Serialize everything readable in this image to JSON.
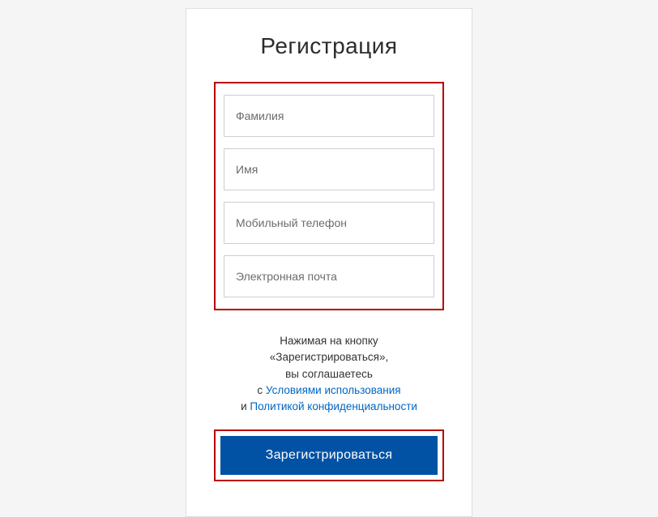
{
  "title": "Регистрация",
  "fields": {
    "lastname_placeholder": "Фамилия",
    "firstname_placeholder": "Имя",
    "phone_placeholder": "Мобильный телефон",
    "email_placeholder": "Электронная почта"
  },
  "consent": {
    "line1": "Нажимая на кнопку",
    "line2": "«Зарегистрироваться»,",
    "line3": "вы соглашаетесь",
    "with": "с ",
    "terms": "Условиями использования",
    "and": "и ",
    "privacy": "Политикой конфиденциальности"
  },
  "submit_label": "Зарегистрироваться"
}
